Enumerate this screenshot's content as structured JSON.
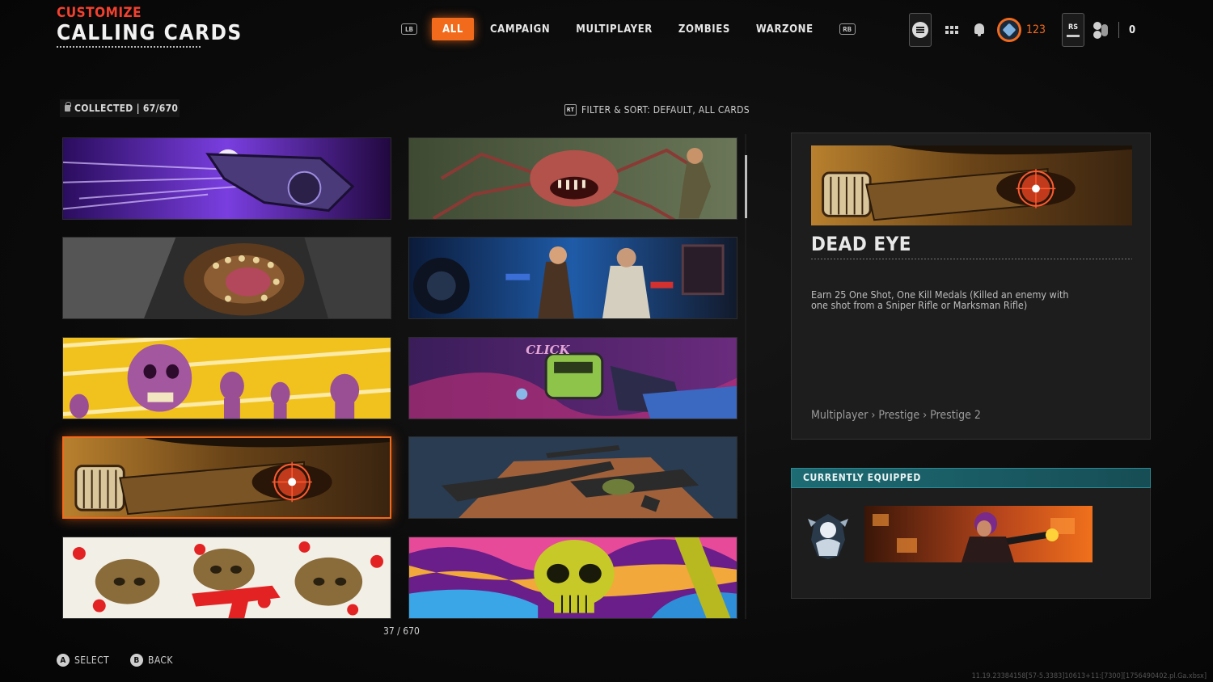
{
  "header": {
    "subtitle": "CUSTOMIZE",
    "title": "CALLING CARDS"
  },
  "tabs": {
    "left_bumper": "LB",
    "right_bumper": "RB",
    "items": [
      {
        "label": "ALL",
        "active": true
      },
      {
        "label": "CAMPAIGN",
        "active": false
      },
      {
        "label": "MULTIPLAYER",
        "active": false
      },
      {
        "label": "ZOMBIES",
        "active": false
      },
      {
        "label": "WARZONE",
        "active": false
      }
    ]
  },
  "topbar": {
    "rank_value": "123",
    "rs_label": "RS",
    "friends_count": "0",
    "icons": [
      "menu-icon",
      "apps-grid-icon",
      "notification-bell-icon",
      "prestige-rank-icon",
      "friends-icon"
    ],
    "accent_color": "#f26a1b"
  },
  "collection": {
    "label": "COLLECTED | 67/670",
    "filter_button": "RT",
    "filter_label": "FILTER & SORT: DEFAULT, ALL CARDS",
    "counter": "37 / 670"
  },
  "cards": [
    {
      "theme": "purple-streak-gun",
      "selected": false
    },
    {
      "theme": "spider-monster-jungle",
      "selected": false
    },
    {
      "theme": "monster-maw-closeup",
      "selected": false
    },
    {
      "theme": "survivors-blue-night",
      "selected": false
    },
    {
      "theme": "zombie-horde-yellow",
      "selected": false
    },
    {
      "theme": "click-counter-purple",
      "selected": false,
      "text": "CLICK"
    },
    {
      "theme": "dead-eye-scope",
      "selected": true
    },
    {
      "theme": "weapons-display-table",
      "selected": false
    },
    {
      "theme": "skulls-helmets-white",
      "selected": false
    },
    {
      "theme": "gold-skull-psychedelic",
      "selected": false
    }
  ],
  "detail": {
    "title": "DEAD EYE",
    "description": "Earn 25 One Shot, One Kill Medals (Killed an enemy with one shot from a Sniper Rifle or Marksman Rifle)",
    "path": "Multiplayer › Prestige › Prestige 2"
  },
  "equipped": {
    "header": "CURRENTLY EQUIPPED",
    "header_color": "#1d6b73"
  },
  "prompts": [
    {
      "button": "A",
      "label": "SELECT"
    },
    {
      "button": "B",
      "label": "BACK"
    }
  ],
  "version": "11.19.23384158[57-5.3383]10613+11:[7300][1756490402.pl.Ga.xbsx]"
}
